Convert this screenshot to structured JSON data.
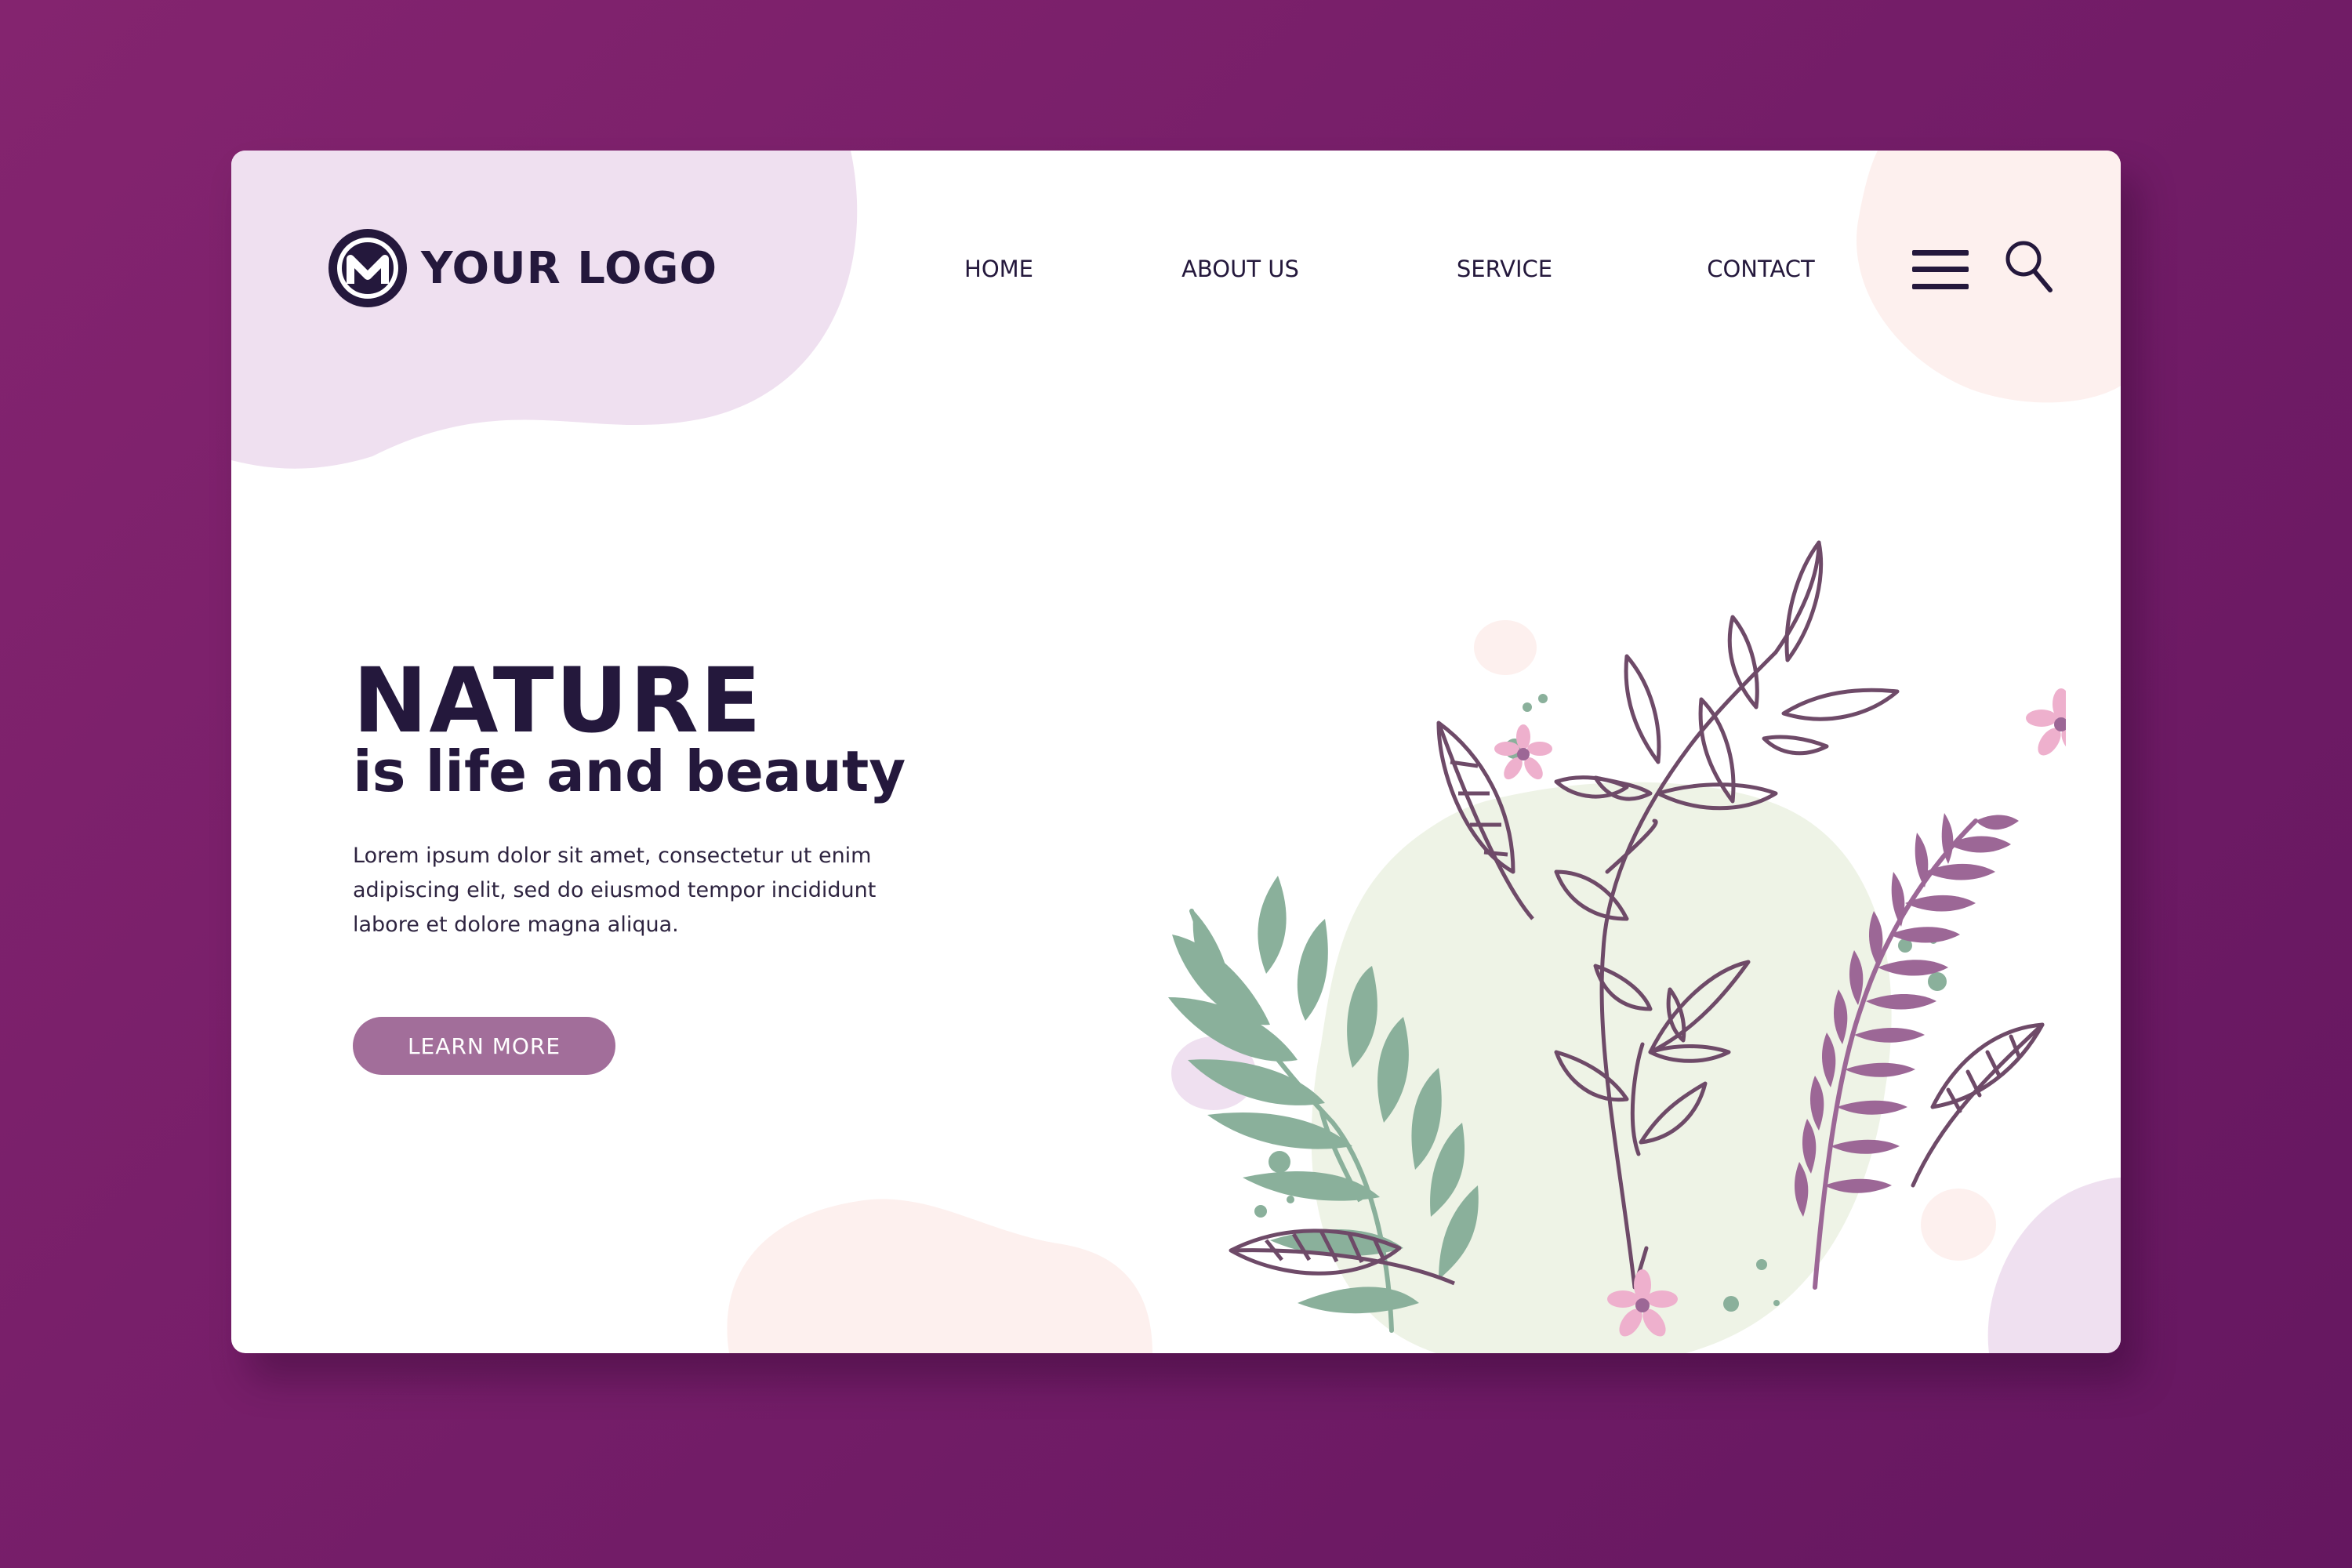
{
  "brand": {
    "logo_text": "YOUR LOGO",
    "logo_icon": "m-monogram-logo"
  },
  "nav": {
    "items": [
      {
        "label": "HOME"
      },
      {
        "label": "ABOUT US"
      },
      {
        "label": "SERVICE"
      },
      {
        "label": "CONTACT"
      }
    ],
    "menu_icon": "hamburger-icon",
    "search_icon": "search-icon"
  },
  "hero": {
    "title": "NATURE",
    "subtitle": "is life and beauty",
    "body": "Lorem ipsum dolor sit amet, consectetur ut enim adipiscing elit, sed do eiusmod tempor incididunt labore et dolore magna aliqua.",
    "cta_label": "LEARN MORE"
  },
  "colors": {
    "background": "#7a1f6c",
    "card": "#ffffff",
    "text_dark": "#24183c",
    "button": "#a26e9a",
    "blob_lilac": "#efe0f0",
    "blob_peach": "#fdf0ee",
    "blob_mint": "#eef3e6",
    "leaf_green": "#8ab09b",
    "leaf_purple": "#9c6796",
    "outline_plum": "#6e4a68",
    "flower_pink": "#eeb0cd"
  }
}
